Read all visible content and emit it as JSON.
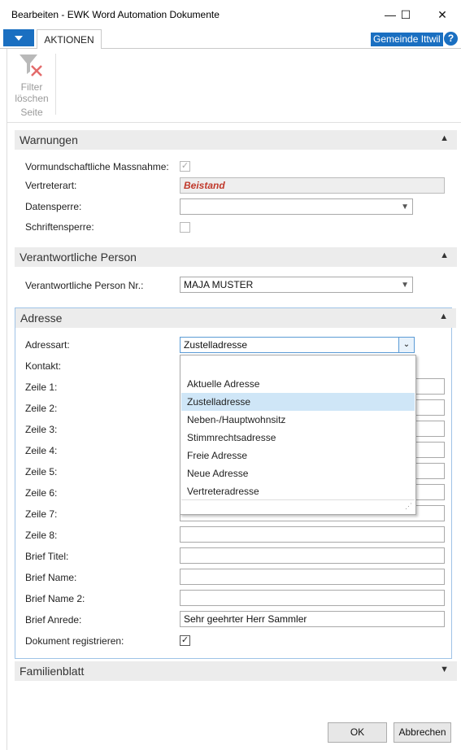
{
  "window": {
    "title": "Bearbeiten - EWK Word Automation Dokumente",
    "minimize": "—",
    "maximize": "☐",
    "close": "✕"
  },
  "ribbon": {
    "tab_aktionen": "AKTIONEN",
    "company": "Gemeinde Ittwil",
    "help": "?",
    "filter_clear_line1": "Filter",
    "filter_clear_line2": "löschen",
    "group_label": "Seite"
  },
  "sections": {
    "warnungen": {
      "title": "Warnungen",
      "vormund_label": "Vormundschaftliche Massnahme:",
      "vormund_checked": true,
      "vertreterart_label": "Vertreterart:",
      "vertreterart_value": "Beistand",
      "datensperre_label": "Datensperre:",
      "datensperre_value": "",
      "schriftensperre_label": "Schriftensperre:",
      "schriftensperre_checked": false
    },
    "verantwortlich": {
      "title": "Verantwortliche Person",
      "nr_label": "Verantwortliche Person Nr.:",
      "nr_value": "MAJA MUSTER"
    },
    "adresse": {
      "title": "Adresse",
      "adressart_label": "Adressart:",
      "adressart_value": "Zustelladresse",
      "kontakt_label": "Kontakt:",
      "zeile1_label": "Zeile 1:",
      "zeile2_label": "Zeile 2:",
      "zeile3_label": "Zeile 3:",
      "zeile4_label": "Zeile 4:",
      "zeile5_label": "Zeile 5:",
      "zeile6_label": "Zeile 6:",
      "zeile7_label": "Zeile 7:",
      "zeile8_label": "Zeile 8:",
      "brief_titel_label": "Brief Titel:",
      "brief_name_label": "Brief Name:",
      "brief_name2_label": "Brief Name 2:",
      "brief_anrede_label": "Brief Anrede:",
      "brief_anrede_value": "Sehr geehrter Herr Sammler",
      "dok_reg_label": "Dokument registrieren:",
      "dok_reg_checked": true,
      "dropdown_options": [
        "",
        "Aktuelle Adresse",
        "Zustelladresse",
        "Neben-/Hauptwohnsitz",
        "Stimmrechtsadresse",
        "Freie Adresse",
        "Neue Adresse",
        "Vertreteradresse"
      ],
      "dropdown_selected": "Zustelladresse"
    },
    "familienblatt": {
      "title": "Familienblatt"
    }
  },
  "buttons": {
    "ok": "OK",
    "cancel": "Abbrechen"
  },
  "colors": {
    "accent": "#1a6fc1",
    "vertreterart_text": "#c0392b",
    "selected_option": "#cfe6f7"
  }
}
